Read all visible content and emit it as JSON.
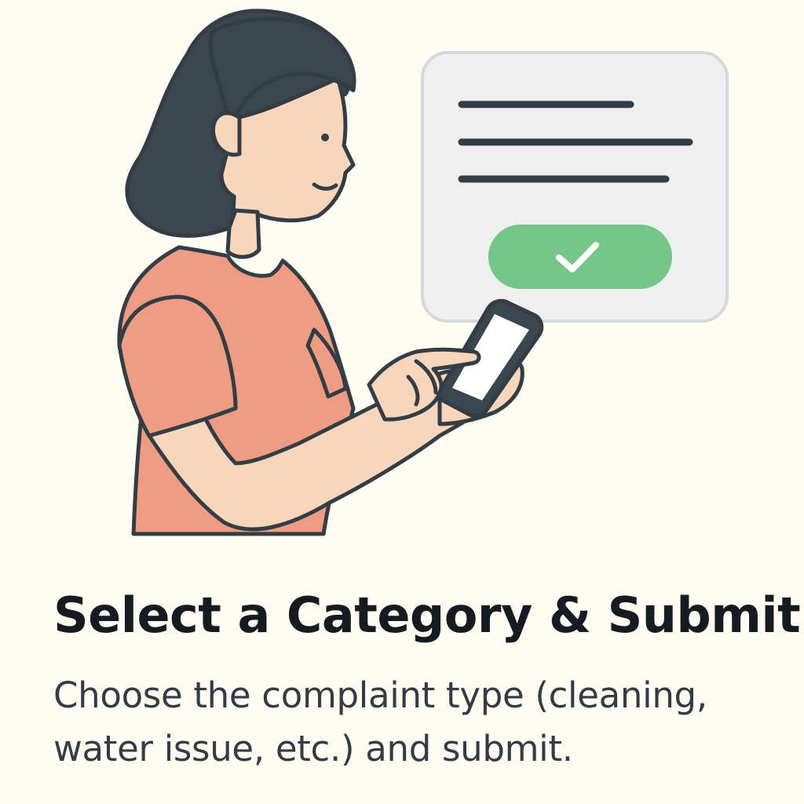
{
  "step": {
    "title": "Select a Category & Submit",
    "description": "Choose the complaint type (cleaning, water issue, etc.) and submit."
  },
  "illustration": {
    "form_card": {
      "lines": 3,
      "submit_icon": "checkmark-icon"
    },
    "colors": {
      "background": "#fffdf2",
      "outline": "#343d44",
      "hair": "#3a474d",
      "skin": "#f7d6bc",
      "shirt": "#ee9c82",
      "card_fill": "#efefef",
      "card_border": "#d6d7da",
      "submit_button": "#76c589",
      "check": "#ffffff"
    }
  }
}
